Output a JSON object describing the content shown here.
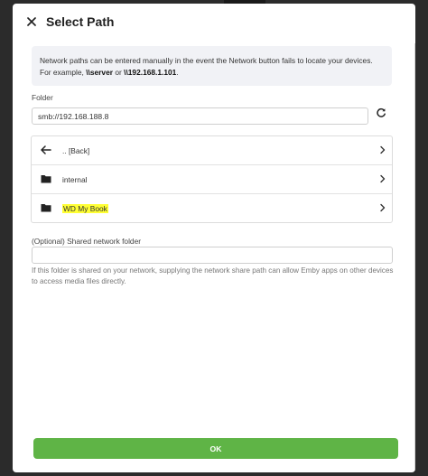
{
  "dialog": {
    "title": "Select Path",
    "close_icon": "close-icon"
  },
  "info": {
    "text_before": "Network paths can be entered manually in the event the Network button fails to locate your devices. For example, ",
    "example_server": "\\\\server",
    "text_or": " or ",
    "example_ip": "\\\\192.168.1.101",
    "text_after": "."
  },
  "folder": {
    "label": "Folder",
    "value": "smb://192.168.188.8",
    "refresh_icon": "refresh-icon"
  },
  "list": {
    "items": [
      {
        "label": ".. [Back]",
        "icon": "arrow-left-icon"
      },
      {
        "label": "internal",
        "icon": "folder-icon"
      },
      {
        "label": "WD My Book",
        "icon": "folder-icon"
      }
    ]
  },
  "shared_folder": {
    "label": "(Optional) Shared network folder",
    "value": "",
    "help": "If this folder is shared on your network, supplying the network share path can allow Emby apps on other devices to access media files directly."
  },
  "actions": {
    "ok_label": "OK"
  },
  "colors": {
    "accent": "#5fb446",
    "highlight": "#ffff33",
    "info_bg": "#f1f2f6"
  }
}
